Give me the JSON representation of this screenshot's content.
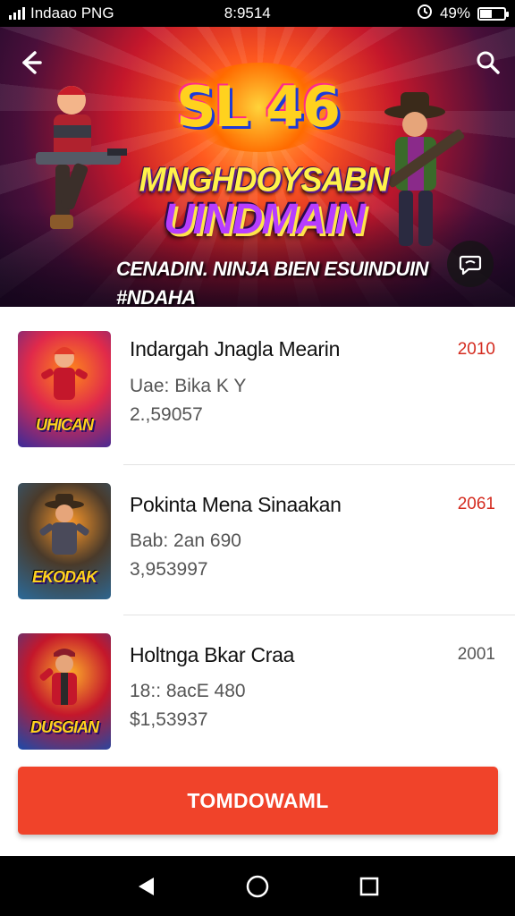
{
  "status_bar": {
    "carrier": "Indaao PNG",
    "time": "8:9514",
    "battery_percent": "49%",
    "battery_level": 0.49,
    "icons": [
      "signal-icon",
      "alarm-icon",
      "battery-icon"
    ]
  },
  "hero": {
    "logo_text": "SL 46",
    "title_line1": "MNGHDOYSABN",
    "title_line2": "UINDMAIN",
    "subtitle_line1": "CENADIN. NINJA BIEN ESUINDUIN",
    "subtitle_line2": "#NDAHA",
    "icons": [
      "back-arrow-icon",
      "search-icon",
      "chat-icon"
    ]
  },
  "games": [
    {
      "title": "Indargah Jnagla Mearin",
      "meta1": "Uae: Bika K Y",
      "meta2": "2.,59057",
      "year": "2010",
      "year_color": "#d42a1e",
      "thumb_label": "UHICAN",
      "thumb_colors": [
        "#3a2a9a",
        "#ff8a1a",
        "#e12a4a"
      ]
    },
    {
      "title": "Pokinta Mena Sinaakan",
      "meta1": "Bab: 2an 690",
      "meta2": "3,953997",
      "year": "2061",
      "year_color": "#d42a1e",
      "thumb_label": "EKODAK",
      "thumb_colors": [
        "#2a6a9a",
        "#ff9a2a",
        "#4a3a2a"
      ]
    },
    {
      "title": "Holtnga Bkar Craa",
      "meta1": "18:: 8acE 480",
      "meta2": "$1,53937",
      "year": "2001",
      "year_color": "#555555",
      "thumb_label": "DUSGIAN",
      "thumb_colors": [
        "#1a4aaa",
        "#ffb22a",
        "#c4172b"
      ]
    }
  ],
  "primary_button": {
    "label": "TOMDOWAML",
    "color": "#f0432a"
  },
  "nav_bar": {
    "icons": [
      "back-triangle-icon",
      "home-circle-icon",
      "recents-square-icon"
    ]
  }
}
